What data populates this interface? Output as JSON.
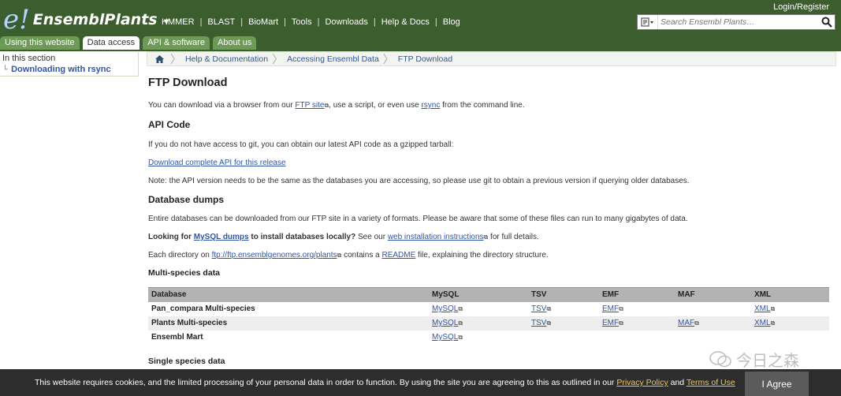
{
  "header": {
    "logo_letter": "e!",
    "logo_text": "EnsemblPlants",
    "nav": [
      "HMMER",
      "BLAST",
      "BioMart",
      "Tools",
      "Downloads",
      "Help & Docs",
      "Blog"
    ],
    "login": "Login/Register",
    "search_placeholder": "Search Ensembl Plants…",
    "tabs": [
      "Using this website",
      "Data access",
      "API & software",
      "About us"
    ],
    "active_tab": "Data access"
  },
  "sidebar": {
    "title": "In this section",
    "link": "Downloading with rsync"
  },
  "breadcrumb": [
    "Help & Documentation",
    "Accessing Ensembl Data",
    "FTP Download"
  ],
  "content": {
    "title": "FTP Download",
    "intro_1": "You can download via a browser from our ",
    "intro_ftp": "FTP site",
    "intro_2": ", use a script, or even use ",
    "intro_rsync": "rsync",
    "intro_3": " from the command line.",
    "api_heading": "API Code",
    "api_text": "If you do not have access to git, you can obtain our latest API code as a gzipped tarball:",
    "api_link": "Download complete API for this release",
    "api_note": "Note: the API version needs to be the same as the databases you are accessing, so please use git to obtain a previous version if querying older databases.",
    "dumps_heading": "Database dumps",
    "dumps_text": "Entire databases can be downloaded from our FTP site in a variety of formats. Please be aware that some of these files can run to many gigabytes of data.",
    "looking_1": "Looking for ",
    "looking_link": "MySQL dumps",
    "looking_2": " to install databases locally?",
    "looking_3": " See our ",
    "looking_web": "web installation instructions",
    "looking_4": " for full details.",
    "dir_1": "Each directory on ",
    "dir_link": "ftp://ftp.ensemblgenomes.org/plants",
    "dir_2": " contains a ",
    "dir_readme": "README",
    "dir_3": " file, explaining the directory structure.",
    "multi_heading": "Multi-species data",
    "single_heading": "Single species data"
  },
  "table": {
    "headers": [
      "Database",
      "MySQL",
      "TSV",
      "EMF",
      "MAF",
      "XML"
    ],
    "rows": [
      [
        "Pan_compara Multi-species",
        "MySQL",
        "TSV",
        "EMF",
        "",
        "XML"
      ],
      [
        "Plants Multi-species",
        "MySQL",
        "TSV",
        "EMF",
        "MAF",
        "XML"
      ],
      [
        "Ensembl Mart",
        "MySQL",
        "",
        "",
        "",
        ""
      ]
    ]
  },
  "cookie": {
    "text": "This website requires cookies, and the limited processing of your personal data in order to function. By using the site you are agreeing to this as outlined in our ",
    "privacy": "Privacy Policy",
    "and": " and ",
    "terms": "Terms of Use",
    "agree": "I Agree"
  },
  "watermark": "今日之森"
}
